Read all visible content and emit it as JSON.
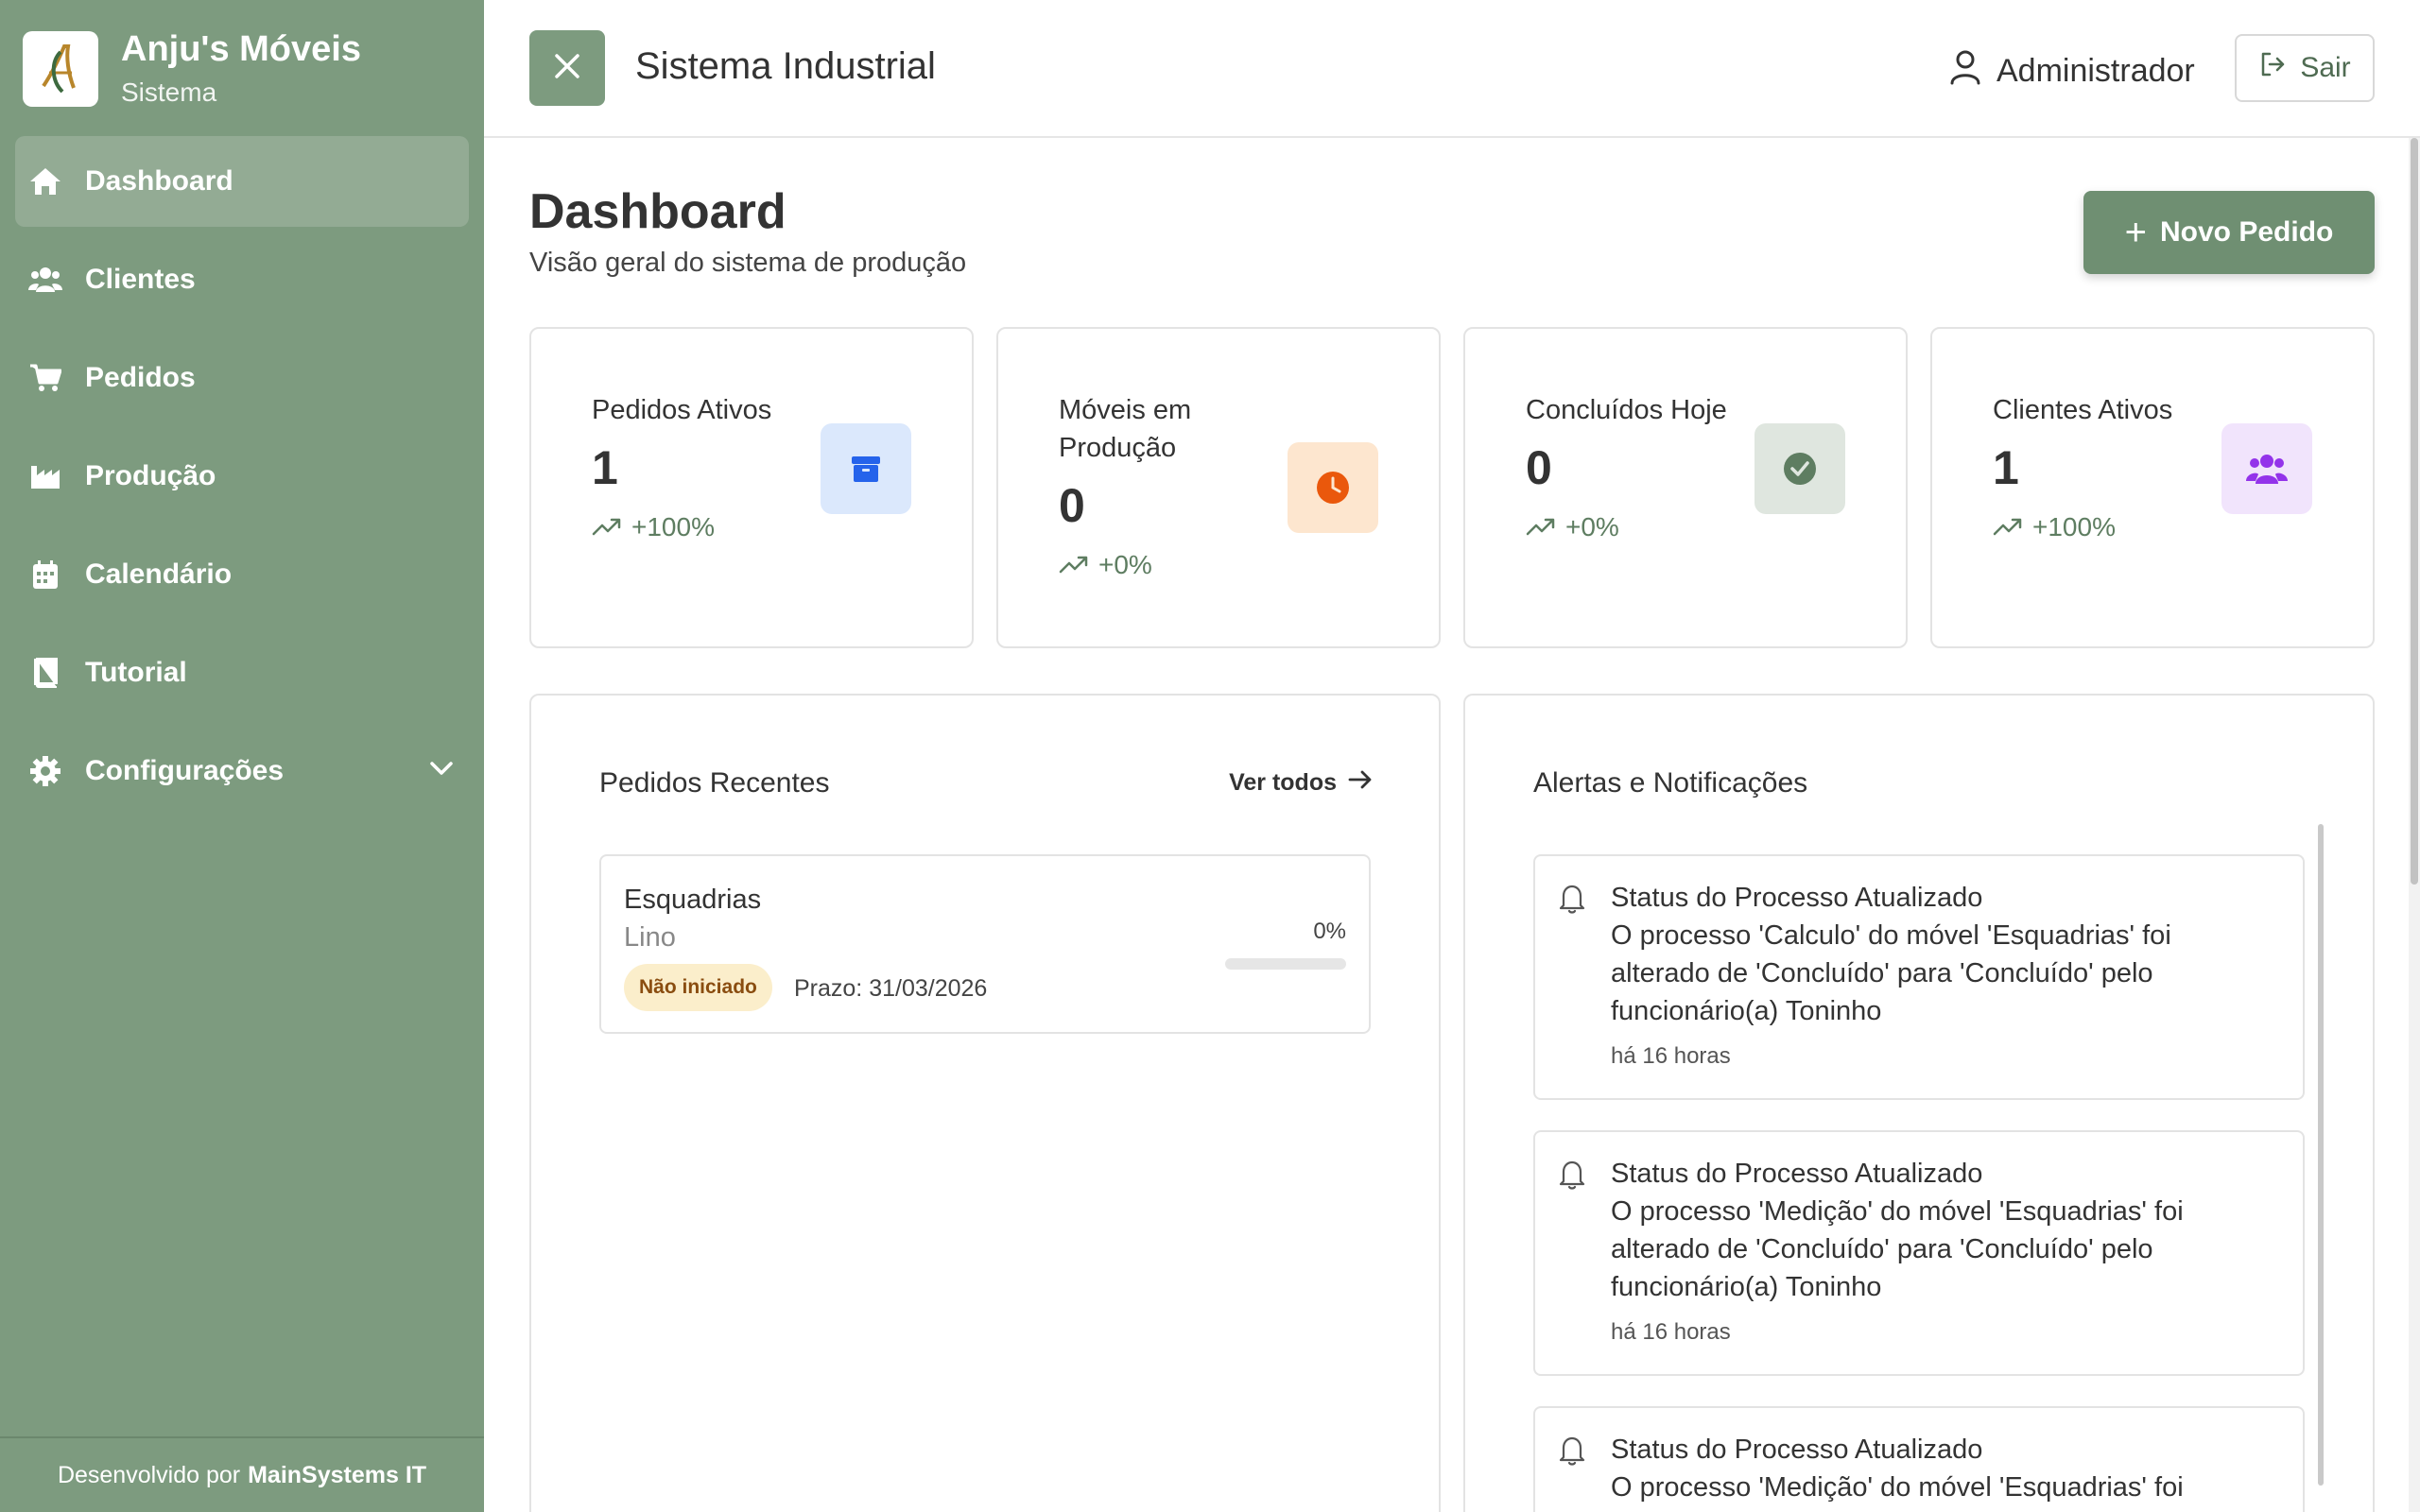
{
  "brand": {
    "name": "Anju's Móveis",
    "subtitle": "Sistema"
  },
  "sidebar": {
    "items": [
      {
        "label": "Dashboard",
        "icon": "home-icon",
        "active": true
      },
      {
        "label": "Clientes",
        "icon": "users-icon"
      },
      {
        "label": "Pedidos",
        "icon": "cart-icon"
      },
      {
        "label": "Produção",
        "icon": "factory-icon"
      },
      {
        "label": "Calendário",
        "icon": "calendar-icon"
      },
      {
        "label": "Tutorial",
        "icon": "book-icon"
      },
      {
        "label": "Configurações",
        "icon": "gear-icon",
        "expandable": true
      }
    ],
    "footer_prefix": "Desenvolvido por",
    "footer_company": "MainSystems IT"
  },
  "header": {
    "title": "Sistema Industrial",
    "user": "Administrador",
    "logout_label": "Sair"
  },
  "page": {
    "title": "Dashboard",
    "subtitle": "Visão geral do sistema de produção",
    "new_order_label": "Novo Pedido"
  },
  "stats": [
    {
      "label": "Pedidos Ativos",
      "value": "1",
      "trend": "+100%",
      "icon": "box-icon",
      "color": "#2563eb",
      "bg": "#dbe8fc"
    },
    {
      "label": "Móveis em Produção",
      "value": "0",
      "trend": "+0%",
      "icon": "clock-icon",
      "color": "#ea580c",
      "bg": "#fde6cf"
    },
    {
      "label": "Concluídos Hoje",
      "value": "0",
      "trend": "+0%",
      "icon": "check-circle-icon",
      "color": "#5e7d61",
      "bg": "#dfe6df"
    },
    {
      "label": "Clientes Ativos",
      "value": "1",
      "trend": "+100%",
      "icon": "users-icon",
      "color": "#9333ea",
      "bg": "#f1e4fc"
    }
  ],
  "recent_orders": {
    "title": "Pedidos Recentes",
    "view_all": "Ver todos",
    "items": [
      {
        "name": "Esquadrias",
        "client": "Lino",
        "status": "Não iniciado",
        "deadline": "Prazo: 31/03/2026",
        "progress_label": "0%",
        "progress": 0
      }
    ]
  },
  "alerts": {
    "title": "Alertas e Notificações",
    "items": [
      {
        "title": "Status do Processo Atualizado",
        "body": "O processo 'Calculo' do móvel 'Esquadrias' foi alterado de 'Concluído' para 'Concluído' pelo funcionário(a) Toninho",
        "time": "há 16 horas"
      },
      {
        "title": "Status do Processo Atualizado",
        "body": "O processo 'Medição' do móvel 'Esquadrias' foi alterado de 'Concluído' para 'Concluído' pelo funcionário(a) Toninho",
        "time": "há 16 horas"
      },
      {
        "title": "Status do Processo Atualizado",
        "body": "O processo 'Medição' do móvel 'Esquadrias' foi",
        "time": ""
      }
    ]
  },
  "colors": {
    "sidebar": "#7d9b7f",
    "sidebar_active": "#93ab94",
    "accent": "#6f8f72",
    "badge_bg": "#fbeecb",
    "badge_text": "#8a4d10"
  }
}
